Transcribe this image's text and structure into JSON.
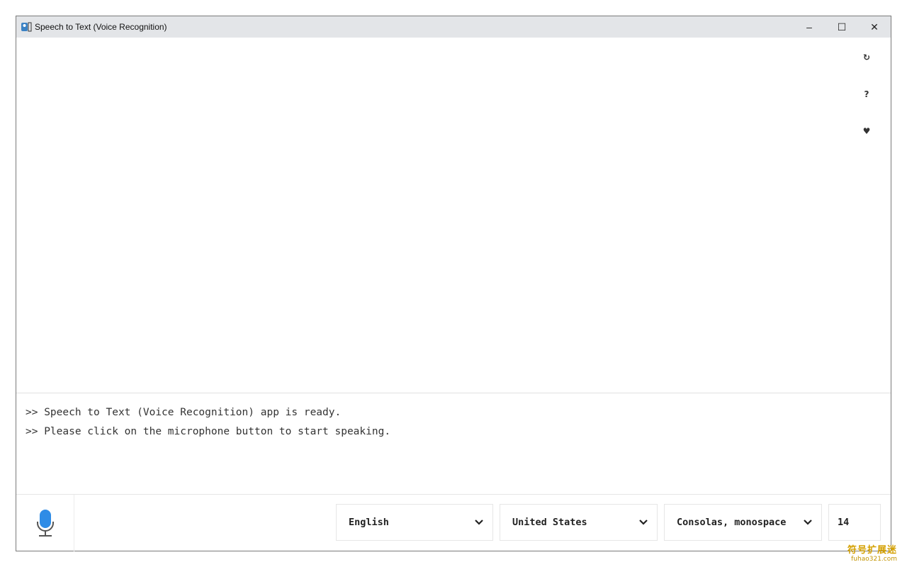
{
  "window": {
    "title": "Speech to Text (Voice Recognition)",
    "controls": {
      "minimize": "–",
      "maximize": "☐",
      "close": "✕"
    }
  },
  "side_toolbar": [
    {
      "icon": "refresh-icon",
      "glyph": "↻"
    },
    {
      "icon": "help-icon",
      "glyph": "?"
    },
    {
      "icon": "heart-icon",
      "glyph": "♥"
    }
  ],
  "log": {
    "lines": [
      ">> Speech to Text (Voice Recognition) app is ready.",
      ">> Please click on the microphone button to start speaking."
    ]
  },
  "controls": {
    "language": "English",
    "region": "United States",
    "font": "Consolas, monospace",
    "font_size": "14"
  },
  "colors": {
    "titlebar": "#e3e5e8",
    "mic_accent": "#2f8ce6"
  },
  "watermark": {
    "top": "符号扩展迷",
    "bottom": "fuhao321.com"
  }
}
